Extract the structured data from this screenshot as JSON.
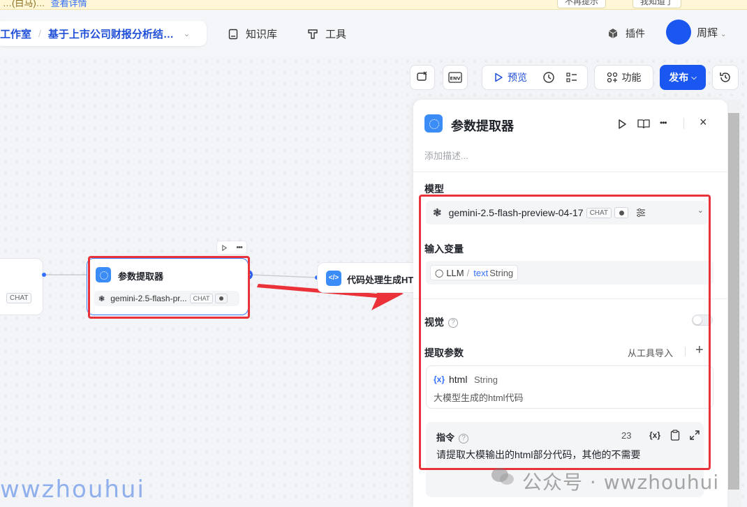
{
  "notice": {
    "text": "…(白马)…",
    "link": "查看详情",
    "btn1": "不再提示",
    "btn2": "我知道了"
  },
  "header": {
    "workspace": "工作室",
    "project": "基于上市公司财报分析结…",
    "nav": [
      "知识库",
      "工具"
    ],
    "plugin": "插件",
    "user": "周辉"
  },
  "toolbar": {
    "preview": "预览",
    "features": "功能",
    "publish": "发布"
  },
  "canvas": {
    "left_node_chip": "CHAT",
    "node_main": {
      "title": "参数提取器",
      "model": "gemini-2.5-flash-pr...",
      "chip": "CHAT"
    },
    "node_next": {
      "title": "代码处理生成HTM"
    }
  },
  "panel": {
    "title": "参数提取器",
    "description_placeholder": "添加描述...",
    "model_label": "模型",
    "model_name": "gemini-2.5-flash-preview-04-17",
    "model_chip": "CHAT",
    "input_label": "输入变量",
    "input_source": "LLM",
    "input_sep": "/",
    "input_var": "text",
    "input_type": "String",
    "vision_label": "视觉",
    "extract_label": "提取参数",
    "import_tools": "从工具导入",
    "param": {
      "name": "html",
      "type": "String",
      "desc": "大模型生成的html代码",
      "prefix": "{x}"
    },
    "instruction_label": "指令",
    "instruction_count": "23",
    "instruction_var_btn": "{x}",
    "instruction_text": "请提取大模输出的html部分代码，其他的不需要"
  },
  "watermark": {
    "left": "wwzhouhui",
    "right": "公众号 · wwzhouhui"
  },
  "colors": {
    "accent": "#1a56f0",
    "highlight": "#e8333a",
    "node_icon": "#3b8cf7"
  }
}
